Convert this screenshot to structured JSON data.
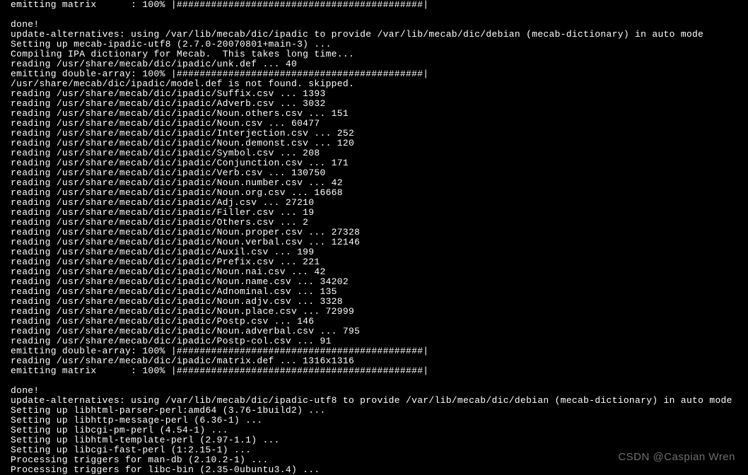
{
  "terminal": {
    "lines": [
      "emitting matrix      : 100% |###########################################| ",
      "",
      "done!",
      "update-alternatives: using /var/lib/mecab/dic/ipadic to provide /var/lib/mecab/dic/debian (mecab-dictionary) in auto mode",
      "Setting up mecab-ipadic-utf8 (2.7.0-20070801+main-3) ...",
      "Compiling IPA dictionary for Mecab.  This takes long time...",
      "reading /usr/share/mecab/dic/ipadic/unk.def ... 40",
      "emitting double-array: 100% |###########################################| ",
      "/usr/share/mecab/dic/ipadic/model.def is not found. skipped.",
      "reading /usr/share/mecab/dic/ipadic/Suffix.csv ... 1393",
      "reading /usr/share/mecab/dic/ipadic/Adverb.csv ... 3032",
      "reading /usr/share/mecab/dic/ipadic/Noun.others.csv ... 151",
      "reading /usr/share/mecab/dic/ipadic/Noun.csv ... 60477",
      "reading /usr/share/mecab/dic/ipadic/Interjection.csv ... 252",
      "reading /usr/share/mecab/dic/ipadic/Noun.demonst.csv ... 120",
      "reading /usr/share/mecab/dic/ipadic/Symbol.csv ... 208",
      "reading /usr/share/mecab/dic/ipadic/Conjunction.csv ... 171",
      "reading /usr/share/mecab/dic/ipadic/Verb.csv ... 130750",
      "reading /usr/share/mecab/dic/ipadic/Noun.number.csv ... 42",
      "reading /usr/share/mecab/dic/ipadic/Noun.org.csv ... 16668",
      "reading /usr/share/mecab/dic/ipadic/Adj.csv ... 27210",
      "reading /usr/share/mecab/dic/ipadic/Filler.csv ... 19",
      "reading /usr/share/mecab/dic/ipadic/Others.csv ... 2",
      "reading /usr/share/mecab/dic/ipadic/Noun.proper.csv ... 27328",
      "reading /usr/share/mecab/dic/ipadic/Noun.verbal.csv ... 12146",
      "reading /usr/share/mecab/dic/ipadic/Auxil.csv ... 199",
      "reading /usr/share/mecab/dic/ipadic/Prefix.csv ... 221",
      "reading /usr/share/mecab/dic/ipadic/Noun.nai.csv ... 42",
      "reading /usr/share/mecab/dic/ipadic/Noun.name.csv ... 34202",
      "reading /usr/share/mecab/dic/ipadic/Adnominal.csv ... 135",
      "reading /usr/share/mecab/dic/ipadic/Noun.adjv.csv ... 3328",
      "reading /usr/share/mecab/dic/ipadic/Noun.place.csv ... 72999",
      "reading /usr/share/mecab/dic/ipadic/Postp.csv ... 146",
      "reading /usr/share/mecab/dic/ipadic/Noun.adverbal.csv ... 795",
      "reading /usr/share/mecab/dic/ipadic/Postp-col.csv ... 91",
      "emitting double-array: 100% |###########################################| ",
      "reading /usr/share/mecab/dic/ipadic/matrix.def ... 1316x1316",
      "emitting matrix      : 100% |###########################################| ",
      "",
      "done!",
      "update-alternatives: using /var/lib/mecab/dic/ipadic-utf8 to provide /var/lib/mecab/dic/debian (mecab-dictionary) in auto mode",
      "Setting up libhtml-parser-perl:amd64 (3.76-1build2) ...",
      "Setting up libhttp-message-perl (6.36-1) ...",
      "Setting up libcgi-pm-perl (4.54-1) ...",
      "Setting up libhtml-template-perl (2.97-1.1) ...",
      "Setting up libcgi-fast-perl (1:2.15-1) ...",
      "Processing triggers for man-db (2.10.2-1) ...",
      "Processing triggers for libc-bin (2.35-0ubuntu3.4) ..."
    ]
  },
  "watermark": {
    "text": "CSDN @Caspian Wren"
  }
}
